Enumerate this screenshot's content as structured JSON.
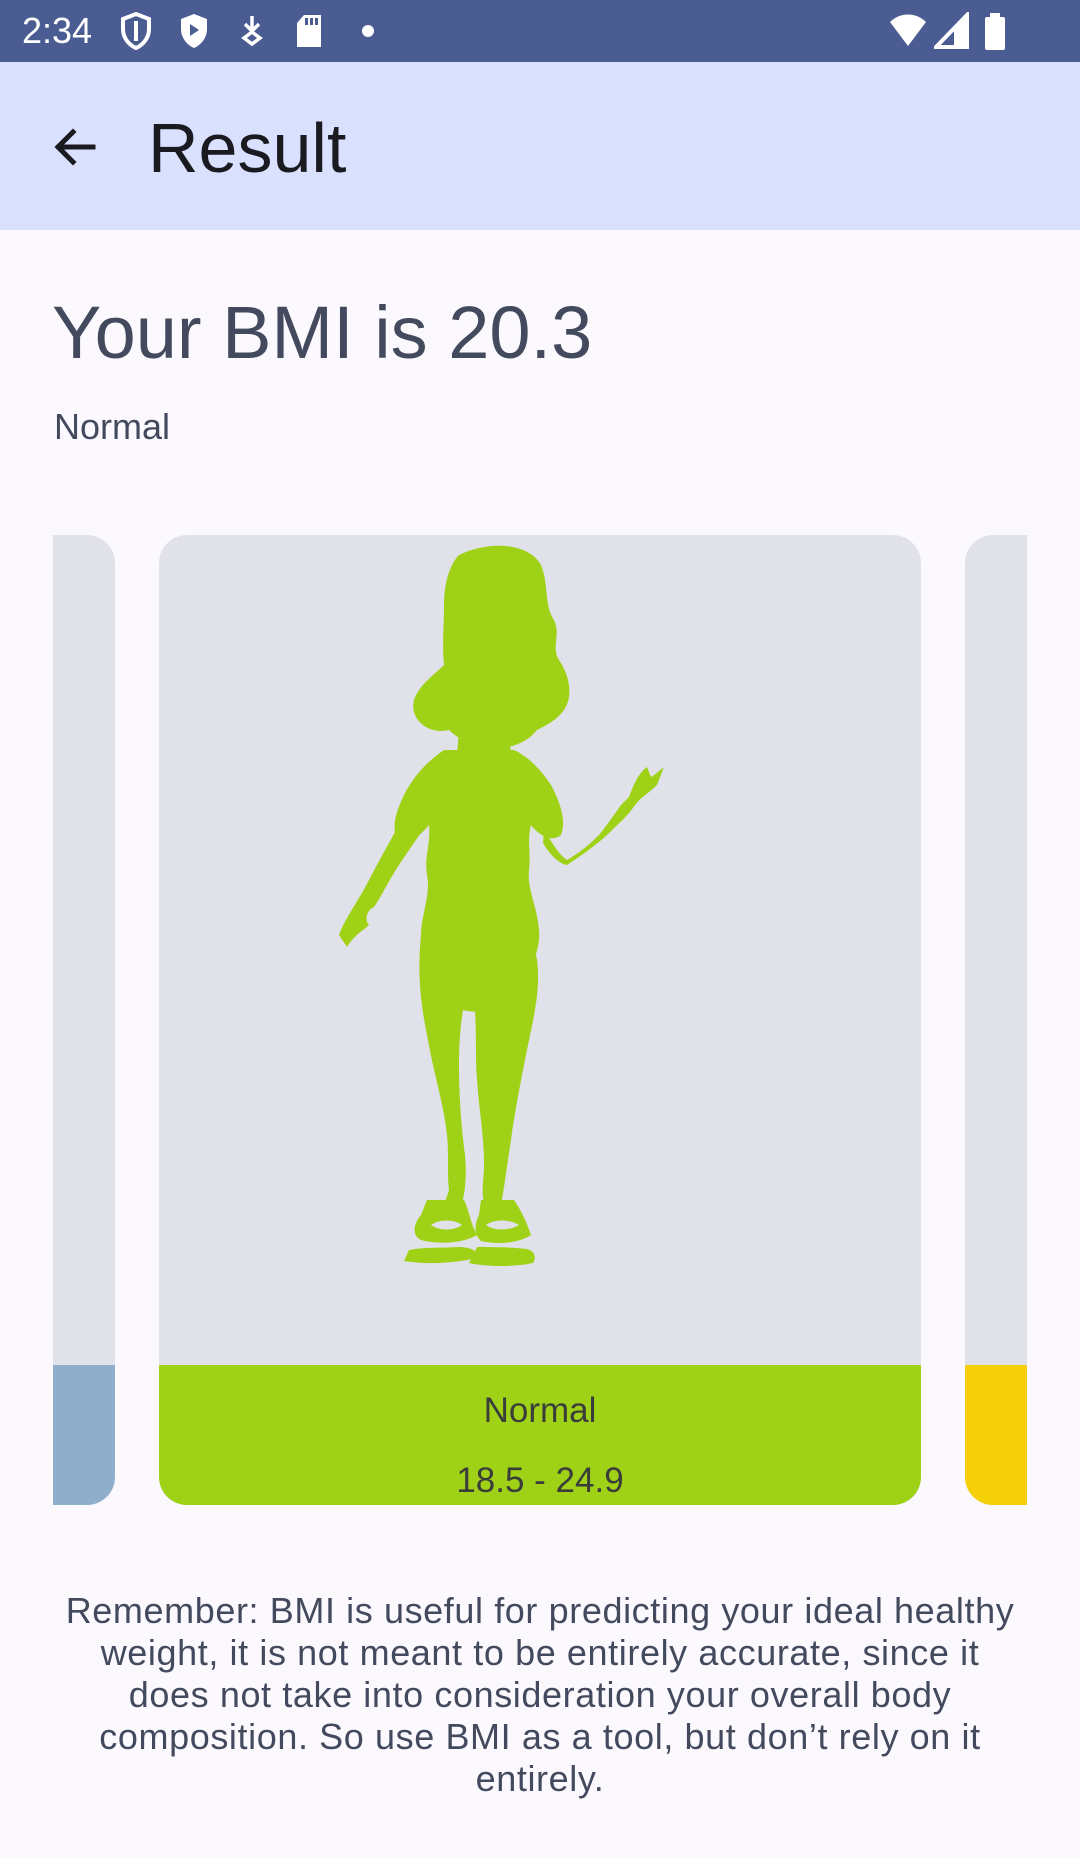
{
  "status_bar": {
    "time": "2:34",
    "icons": [
      "shield-outline-icon",
      "shield-icon",
      "download-icon",
      "sd-card-icon",
      "dot-icon",
      "wifi-icon",
      "signal-icon",
      "battery-icon"
    ]
  },
  "app_bar": {
    "title": "Result",
    "back_icon": "arrow-back-icon"
  },
  "result": {
    "heading": "Your BMI is 20.3",
    "category": "Normal"
  },
  "cards": {
    "current": {
      "name": "Normal",
      "range": "18.5 - 24.9",
      "color": "#9fd216"
    },
    "previous": {
      "color": "#8faecb"
    },
    "next": {
      "color": "#f5d009"
    }
  },
  "disclaimer": "Remember: BMI is useful for predicting your ideal healthy weight, it is not meant to be entirely accurate, since it does not take into consideration your overall body composition. So use BMI as a tool, but don’t rely on it entirely.",
  "colors": {
    "status_bar": "#4b5c92",
    "app_bar": "#dae1ff",
    "background": "#fcf9fe",
    "card": "#e1e1ea"
  }
}
